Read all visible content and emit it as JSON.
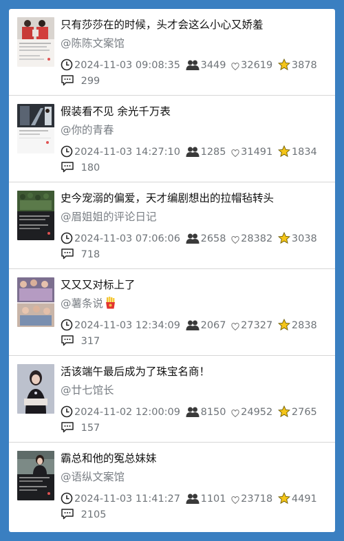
{
  "posts": [
    {
      "title": "只有莎莎在的时候，头才会这么小心又娇羞",
      "author": "@陈陈文案馆",
      "time": "2024-11-03 09:08:35",
      "readers": "3449",
      "likes": "32619",
      "stars": "3878",
      "comments": "299"
    },
    {
      "title": "假装看不见 余光千万表",
      "author": "@你的青春",
      "time": "2024-11-03 14:27:10",
      "readers": "1285",
      "likes": "31491",
      "stars": "1834",
      "comments": "180"
    },
    {
      "title": "史今宠溺的偏爱，天才编剧想出的拉帽毡转头",
      "author": "@眉姐姐的评论日记",
      "time": "2024-11-03 07:06:06",
      "readers": "2658",
      "likes": "28382",
      "stars": "3038",
      "comments": "718"
    },
    {
      "title": "又又又对标上了",
      "author": "@薯条说",
      "author_emoji": "fries-emoji",
      "time": "2024-11-03 12:34:09",
      "readers": "2067",
      "likes": "27327",
      "stars": "2838",
      "comments": "317"
    },
    {
      "title": "活该端午最后成为了珠宝名商！",
      "author": "@廿七馆长",
      "time": "2024-11-02 12:00:09",
      "readers": "8150",
      "likes": "24952",
      "stars": "2765",
      "comments": "157"
    },
    {
      "title": "霸总和他的冤总妹妹",
      "author": "@语纵文案馆",
      "time": "2024-11-03 11:41:27",
      "readers": "1101",
      "likes": "23718",
      "stars": "4491",
      "comments": "2105"
    }
  ],
  "icons": {
    "time": "clock-icon",
    "readers": "people-icon",
    "likes": "heart-icon",
    "stars": "star-icon",
    "comments": "comment-icon"
  },
  "colors": {
    "background": "#3a7fc1",
    "card": "#ffffff",
    "star": "#f5c518",
    "meta_text": "#6e7378",
    "author": "#7a7f85"
  }
}
